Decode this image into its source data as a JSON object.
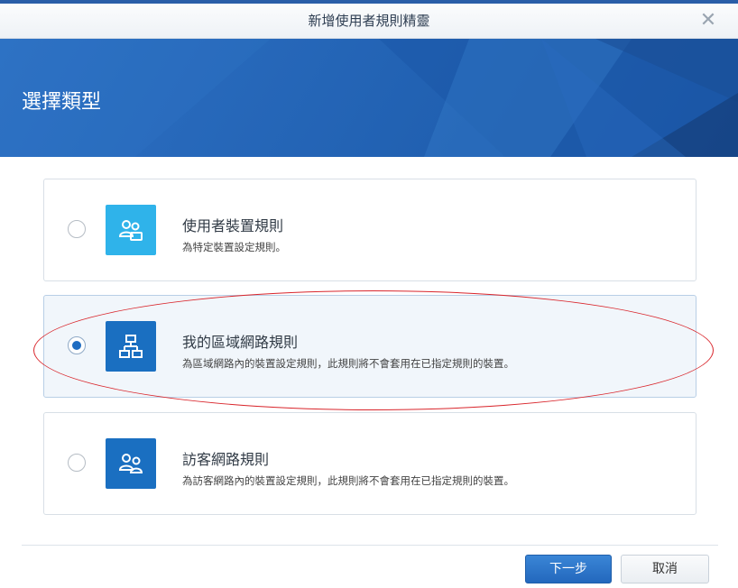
{
  "window": {
    "title": "新增使用者規則精靈",
    "close_glyph": "✕"
  },
  "banner": {
    "title": "選擇類型"
  },
  "options": [
    {
      "title": "使用者裝置規則",
      "description": "為特定裝置設定規則。",
      "selected": false,
      "icon": "user-devices-icon"
    },
    {
      "title": "我的區域網路規則",
      "description": "為區域網路內的裝置設定規則，此規則將不會套用在已指定規則的裝置。",
      "selected": true,
      "icon": "network-topology-icon"
    },
    {
      "title": "訪客網路規則",
      "description": "為訪客網路內的裝置設定規則，此規則將不會套用在已指定規則的裝置。",
      "selected": false,
      "icon": "guest-users-icon"
    }
  ],
  "footer": {
    "next_label": "下一步",
    "cancel_label": "取消"
  },
  "colors": {
    "accent": "#1f6dc2",
    "icon_light": "#2fb3ea",
    "icon_dark": "#1a6fc1",
    "annotation": "#d9262c"
  }
}
